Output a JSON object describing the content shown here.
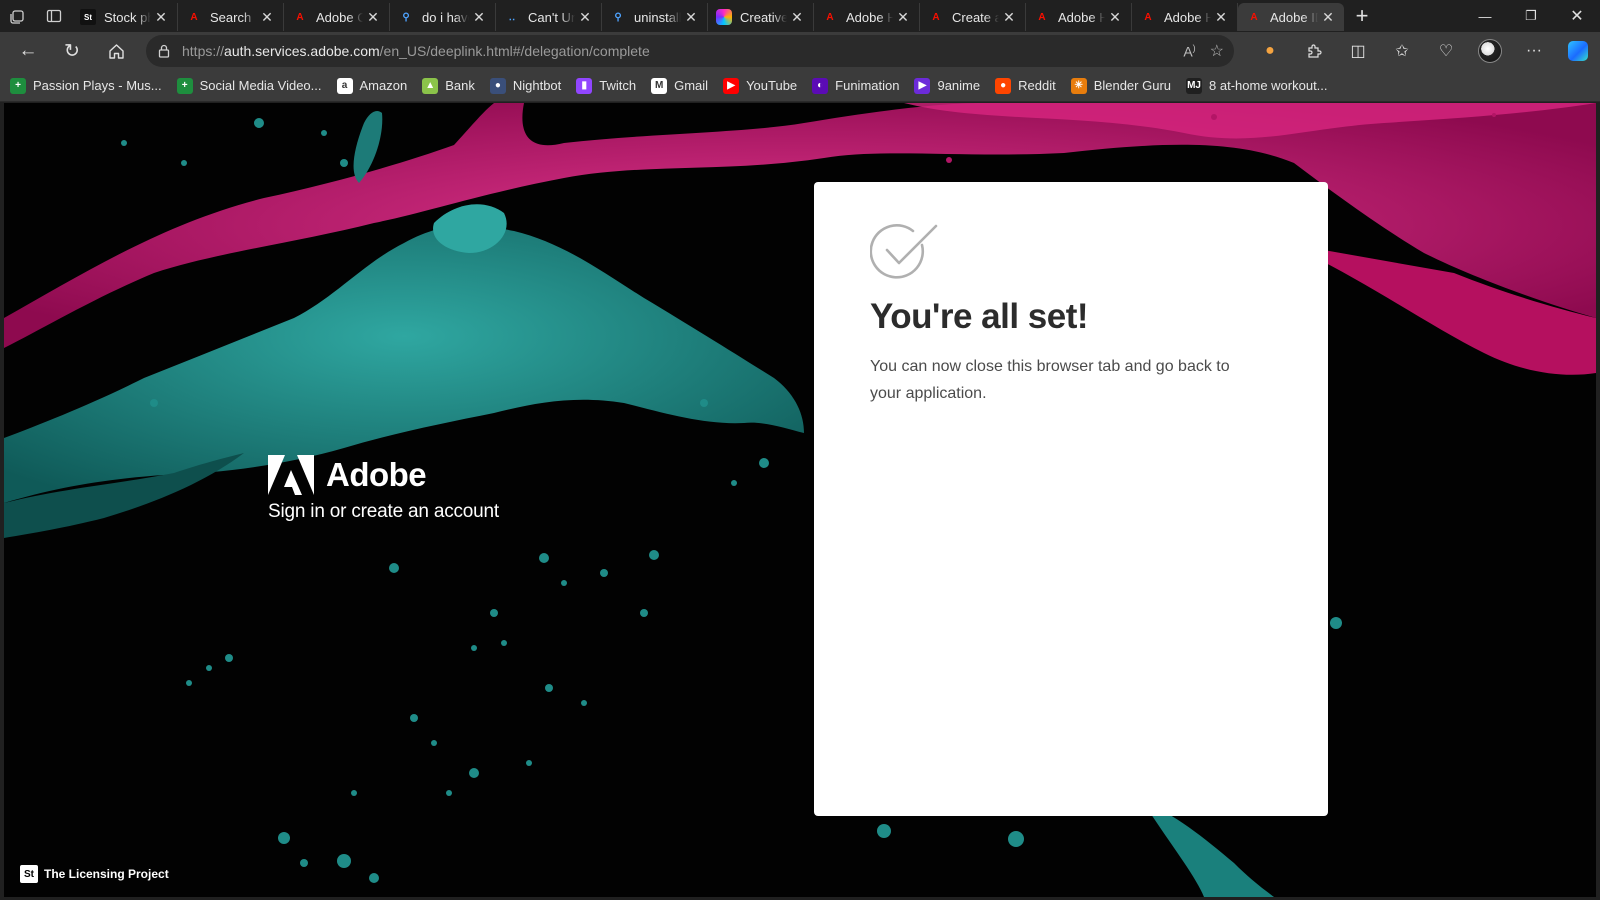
{
  "browser": {
    "tabs": [
      {
        "title": "Stock photos",
        "icon": "adobe-stock-icon",
        "fav": "St"
      },
      {
        "title": "Search",
        "icon": "adobe-icon",
        "fav": "A"
      },
      {
        "title": "Adobe Creative",
        "icon": "adobe-icon",
        "fav": "A"
      },
      {
        "title": "do i have",
        "icon": "search-icon",
        "fav": "⚲"
      },
      {
        "title": "Can't Uninstall",
        "icon": "community-icon",
        "fav": "‥"
      },
      {
        "title": "uninstall",
        "icon": "search-icon",
        "fav": "⚲"
      },
      {
        "title": "Creative Cloud",
        "icon": "creative-cloud-icon",
        "fav": ""
      },
      {
        "title": "Adobe Help",
        "icon": "adobe-icon",
        "fav": "A"
      },
      {
        "title": "Create an account",
        "icon": "adobe-icon",
        "fav": "A"
      },
      {
        "title": "Adobe Help",
        "icon": "adobe-icon",
        "fav": "A"
      },
      {
        "title": "Adobe Help",
        "icon": "adobe-icon",
        "fav": "A"
      },
      {
        "title": "Adobe ID",
        "icon": "adobe-icon",
        "fav": "A",
        "active": true
      }
    ],
    "new_tab_glyph": "+",
    "url_prefix": "https://",
    "url_host": "auth.services.adobe.com",
    "url_path": "/en_US/deeplink.html#/delegation/complete",
    "bookmarks": [
      {
        "label": "Passion Plays - Mus...",
        "icon": "sheets-icon",
        "color": "#1e8e3e",
        "glyph": "+"
      },
      {
        "label": "Social Media Video...",
        "icon": "sheets-icon",
        "color": "#1e8e3e",
        "glyph": "+"
      },
      {
        "label": "Amazon",
        "icon": "amazon-icon",
        "color": "#ffffff",
        "glyph": "a"
      },
      {
        "label": "Bank",
        "icon": "bank-icon",
        "color": "#8bc34a",
        "glyph": "▲"
      },
      {
        "label": "Nightbot",
        "icon": "nightbot-icon",
        "color": "#3a4f7a",
        "glyph": "●"
      },
      {
        "label": "Twitch",
        "icon": "twitch-icon",
        "color": "#9146ff",
        "glyph": "▮"
      },
      {
        "label": "Gmail",
        "icon": "gmail-icon",
        "color": "#ffffff",
        "glyph": "M"
      },
      {
        "label": "YouTube",
        "icon": "youtube-icon",
        "color": "#ff0000",
        "glyph": "▶"
      },
      {
        "label": "Funimation",
        "icon": "funimation-icon",
        "color": "#5b0bb5",
        "glyph": "◐"
      },
      {
        "label": "9anime",
        "icon": "9anime-icon",
        "color": "#6c2bd9",
        "glyph": "▶"
      },
      {
        "label": "Reddit",
        "icon": "reddit-icon",
        "color": "#ff4500",
        "glyph": "●"
      },
      {
        "label": "Blender Guru",
        "icon": "blender-guru-icon",
        "color": "#e87d0d",
        "glyph": "✳"
      },
      {
        "label": "8 at-home workout...",
        "icon": "mj-icon",
        "color": "#202020",
        "glyph": "MJ"
      }
    ]
  },
  "page": {
    "brand_name": "Adobe",
    "tagline": "Sign in or create an account",
    "card_title": "You're all set!",
    "card_message": "You can now close this browser tab and go back to your application.",
    "credit_badge": "St",
    "credit_text": "The Licensing Project",
    "colors": {
      "adobe_red": "#fa0f00",
      "splash_pink": "#c8126e",
      "splash_teal": "#1a8a86",
      "background": "#020202"
    }
  }
}
